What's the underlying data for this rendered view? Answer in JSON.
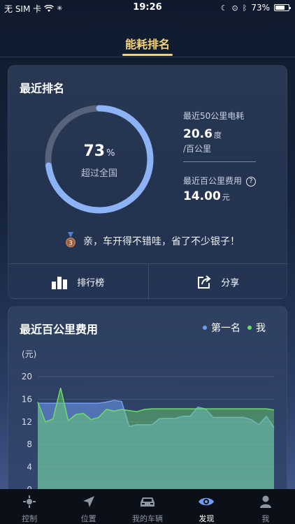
{
  "status": {
    "carrier": "无 SIM 卡",
    "time": "19:26",
    "battery": "73%",
    "battery_level": 0.73
  },
  "nav": {
    "title": "能耗排名"
  },
  "ranking": {
    "title": "最近排名",
    "percent": "73",
    "percent_unit": "%",
    "percent_value": 73,
    "percent_sub": "超过全国",
    "stat1_label": "最近50公里电耗",
    "stat1_value": "20.6",
    "stat1_unit": "度",
    "stat1_sub": "/百公里",
    "stat2_label": "最近百公里费用",
    "stat2_value": "14.00",
    "stat2_unit": "元",
    "medal_number": "3",
    "praise": "亲，车开得不错哇，省了不少银子！",
    "actions": {
      "ranking": "排行榜",
      "share": "分享"
    }
  },
  "cost_chart": {
    "title": "最近百公里费用",
    "legend_first": "第一名",
    "legend_me": "我",
    "y_unit": "(元)",
    "colors": {
      "first": "#6f9cf2",
      "me": "#6ddc6a"
    }
  },
  "chart_data": {
    "type": "area",
    "ylabel": "(元)",
    "ylim": [
      0,
      20
    ],
    "yticks": [
      "20",
      "16",
      "12",
      "8",
      "4",
      "0"
    ],
    "series": [
      {
        "name": "第一名",
        "values": [
          15.3,
          15.3,
          15.3,
          15.3,
          15.3,
          15.3,
          15.3,
          15.3,
          15.3,
          15.5,
          15.8,
          15.6,
          11.2,
          11.5,
          11.5,
          11.5,
          12.6,
          12.6,
          12.6,
          13.0,
          13.0,
          14.6,
          14.3,
          12.8,
          12.8,
          12.8,
          12.8,
          12.8,
          12.4,
          11.5,
          13.0,
          11.0
        ]
      },
      {
        "name": "我",
        "values": [
          15.5,
          12.0,
          12.5,
          18.0,
          12.2,
          13.3,
          13.5,
          12.4,
          12.8,
          14.2,
          13.9,
          14.2,
          14.0,
          13.8,
          14.2,
          14.3,
          14.3,
          14.3,
          14.3,
          14.3,
          14.3,
          14.3,
          14.3,
          14.3,
          14.3,
          14.3,
          14.3,
          14.3,
          14.3,
          14.3,
          14.3,
          14.1
        ]
      }
    ]
  },
  "tabs": [
    {
      "label": "控制",
      "icon": "control-icon"
    },
    {
      "label": "位置",
      "icon": "location-icon"
    },
    {
      "label": "我的车辆",
      "icon": "car-icon"
    },
    {
      "label": "发现",
      "icon": "eye-icon"
    },
    {
      "label": "我",
      "icon": "person-icon"
    }
  ]
}
